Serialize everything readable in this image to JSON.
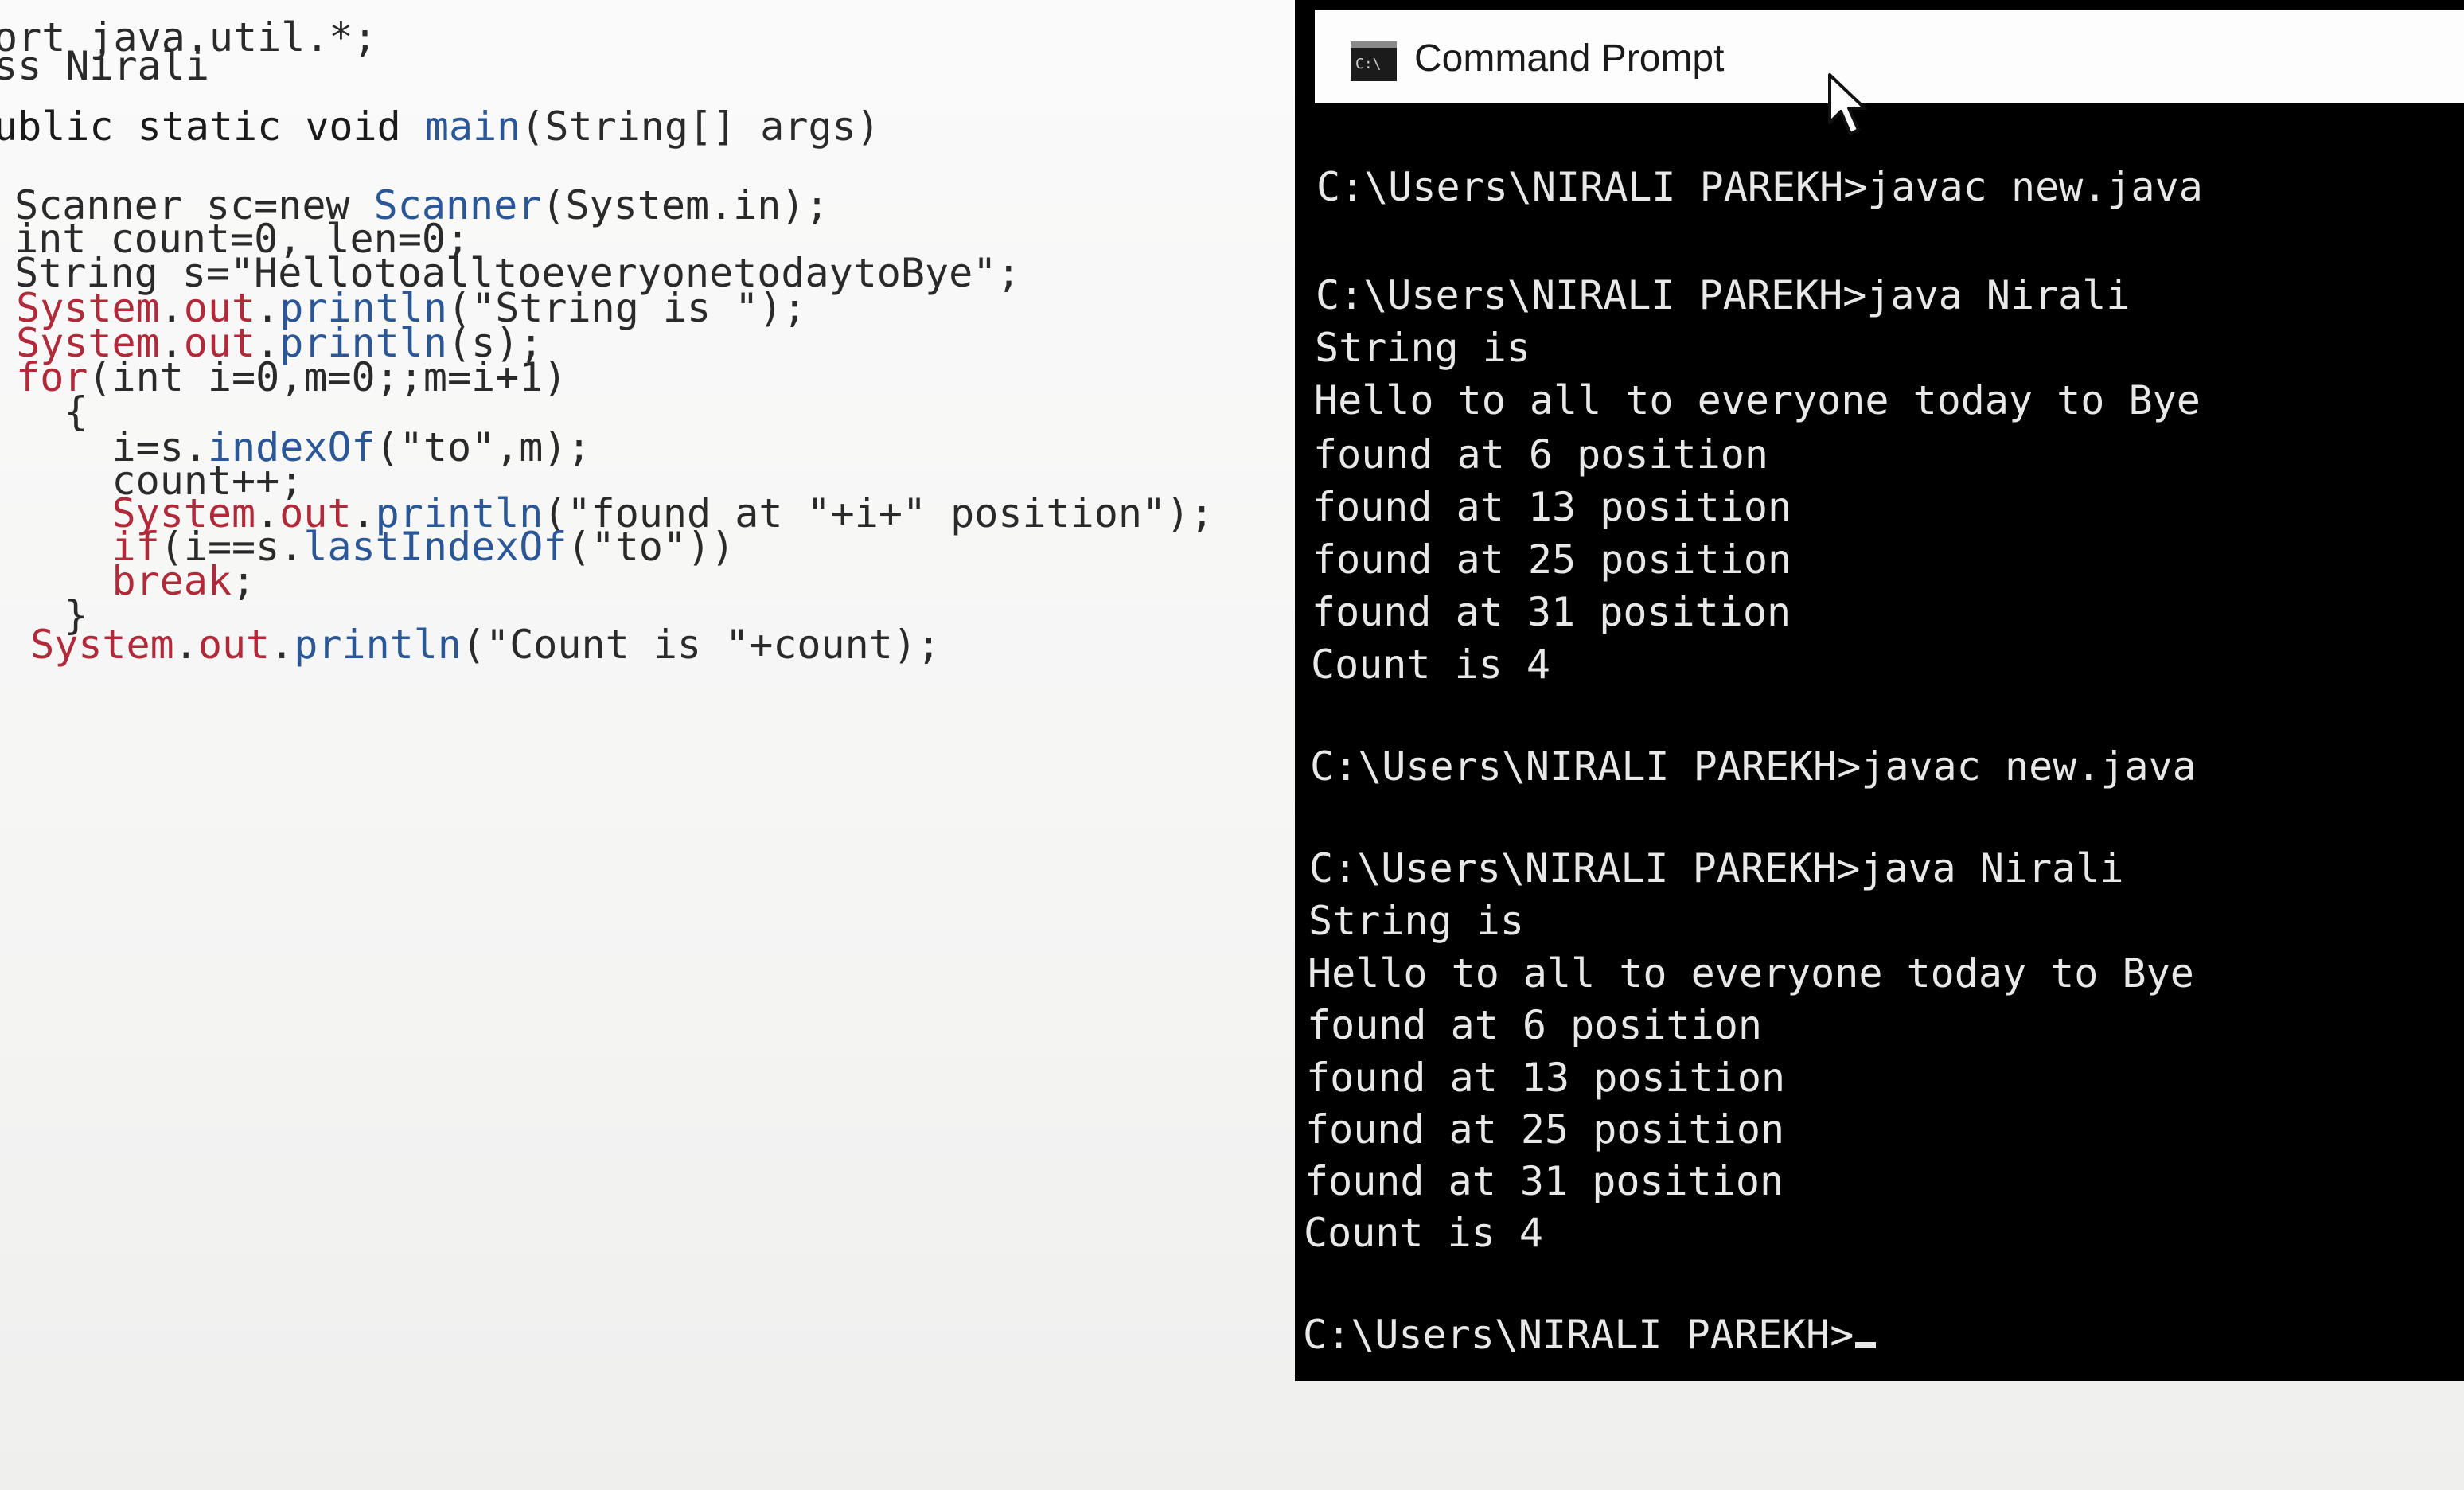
{
  "editor": {
    "lines": [
      [
        {
          "t": "ort java.util.*;",
          "c": "plain"
        }
      ],
      [
        {
          "t": "ss Nirali",
          "c": "plain"
        }
      ],
      [
        {
          "t": "ublic static void ",
          "c": "kw"
        },
        {
          "t": "main",
          "c": "blue"
        },
        {
          "t": "(String[] args)",
          "c": "plain"
        }
      ],
      [
        {
          "t": " Scanner sc=new ",
          "c": "plain"
        },
        {
          "t": "Scanner",
          "c": "blue"
        },
        {
          "t": "(System.in);",
          "c": "plain"
        }
      ],
      [
        {
          "t": " int count=0, len=0;",
          "c": "plain"
        }
      ],
      [
        {
          "t": " String s=\"HellotoalltoeveryonetodaytoBye\";",
          "c": "plain"
        }
      ],
      [
        {
          "t": " ",
          "c": "plain"
        },
        {
          "t": "System",
          "c": "red"
        },
        {
          "t": ".",
          "c": "plain"
        },
        {
          "t": "out",
          "c": "red"
        },
        {
          "t": ".",
          "c": "plain"
        },
        {
          "t": "println",
          "c": "blue"
        },
        {
          "t": "(\"String is \");",
          "c": "plain"
        }
      ],
      [
        {
          "t": " ",
          "c": "plain"
        },
        {
          "t": "System",
          "c": "red"
        },
        {
          "t": ".",
          "c": "plain"
        },
        {
          "t": "out",
          "c": "red"
        },
        {
          "t": ".",
          "c": "plain"
        },
        {
          "t": "println",
          "c": "blue"
        },
        {
          "t": "(s);",
          "c": "plain"
        }
      ],
      [
        {
          "t": " ",
          "c": "plain"
        },
        {
          "t": "for",
          "c": "red"
        },
        {
          "t": "(int i=0,m=0;;m=i+1)",
          "c": "plain"
        }
      ],
      [
        {
          "t": "   {",
          "c": "plain"
        }
      ],
      [
        {
          "t": "     i=s.",
          "c": "plain"
        },
        {
          "t": "indexOf",
          "c": "blue"
        },
        {
          "t": "(\"to\",m);",
          "c": "plain"
        }
      ],
      [
        {
          "t": "     count++;",
          "c": "plain"
        }
      ],
      [
        {
          "t": "     ",
          "c": "plain"
        },
        {
          "t": "System",
          "c": "red"
        },
        {
          "t": ".",
          "c": "plain"
        },
        {
          "t": "out",
          "c": "red"
        },
        {
          "t": ".",
          "c": "plain"
        },
        {
          "t": "println",
          "c": "blue"
        },
        {
          "t": "(\"found at \"+i+\" position\");",
          "c": "plain"
        }
      ],
      [
        {
          "t": "     ",
          "c": "plain"
        },
        {
          "t": "if",
          "c": "red"
        },
        {
          "t": "(i==s.",
          "c": "plain"
        },
        {
          "t": "lastIndexOf",
          "c": "blue"
        },
        {
          "t": "(\"to\"))",
          "c": "plain"
        }
      ],
      [
        {
          "t": "     ",
          "c": "plain"
        },
        {
          "t": "break",
          "c": "red"
        },
        {
          "t": ";",
          "c": "plain"
        }
      ],
      [
        {
          "t": "   }",
          "c": "plain"
        }
      ],
      [
        {
          "t": " ",
          "c": "plain"
        },
        {
          "t": "System",
          "c": "red"
        },
        {
          "t": ".",
          "c": "plain"
        },
        {
          "t": "out",
          "c": "red"
        },
        {
          "t": ".",
          "c": "plain"
        },
        {
          "t": "println",
          "c": "blue"
        },
        {
          "t": "(\"Count is \"+count);",
          "c": "plain"
        }
      ]
    ]
  },
  "cmd": {
    "title": "Command Prompt",
    "lines": [
      "C:\\Users\\NIRALI PAREKH>javac new.java",
      "C:\\Users\\NIRALI PAREKH>java Nirali",
      "String is",
      "Hello to all to everyone today to Bye",
      "found at 6 position",
      "found at 13 position",
      "found at 25 position",
      "found at 31 position",
      "Count is 4",
      "C:\\Users\\NIRALI PAREKH>javac new.java",
      "C:\\Users\\NIRALI PAREKH>java Nirali",
      "String is",
      "Hello to all to everyone today to Bye",
      "found at 6 position",
      "found at 13 position",
      "found at 25 position",
      "found at 31 position",
      "Count is 4",
      "C:\\Users\\NIRALI PAREKH>"
    ]
  },
  "colors": {
    "editor_background": "#f7f7f6",
    "keyword_blue": "#2b5796",
    "keyword_red": "#b02a3a",
    "terminal_background": "#000000",
    "terminal_text": "#e8e8e8"
  },
  "icons": {
    "cmd_window_icon": "console-icon",
    "mouse_pointer": "pointer-arrow-icon"
  }
}
